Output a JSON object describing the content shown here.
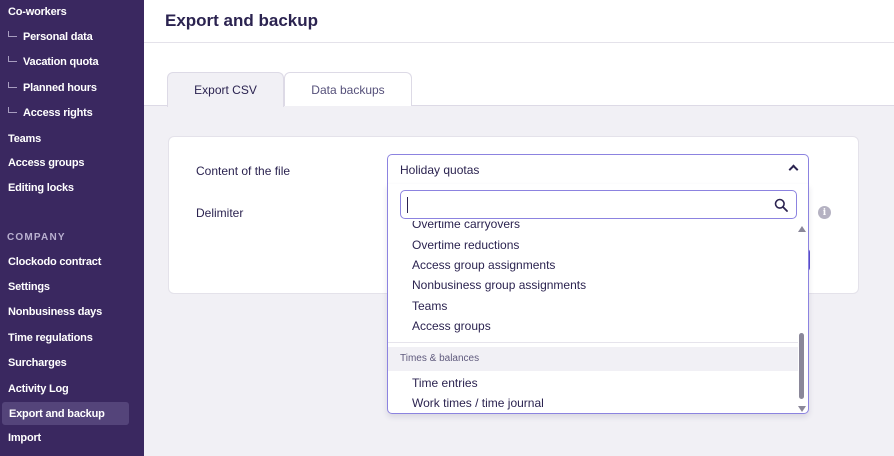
{
  "sidebar": {
    "items_top": [
      {
        "label": "Co-workers"
      },
      {
        "label": "Personal data"
      },
      {
        "label": "Vacation quota"
      },
      {
        "label": "Planned hours"
      },
      {
        "label": "Access rights"
      },
      {
        "label": "Teams"
      },
      {
        "label": "Access groups"
      },
      {
        "label": "Editing locks"
      }
    ],
    "section_company": "COMPANY",
    "items_company": [
      {
        "label": "Clockodo contract"
      },
      {
        "label": "Settings"
      },
      {
        "label": "Nonbusiness days"
      },
      {
        "label": "Time regulations"
      },
      {
        "label": "Surcharges"
      },
      {
        "label": "Activity Log"
      },
      {
        "label": "Export and backup"
      },
      {
        "label": "Import"
      }
    ]
  },
  "header": {
    "title": "Export and backup"
  },
  "tabs": [
    {
      "label": "Export CSV",
      "active": true
    },
    {
      "label": "Data backups",
      "active": false
    }
  ],
  "form": {
    "content_label": "Content of the file",
    "delimiter_label": "Delimiter",
    "info_icon": "i"
  },
  "select": {
    "value": "Holiday quotas",
    "search_placeholder": "",
    "options_partial": "Overtime carryovers",
    "options": [
      {
        "label": "Overtime reductions"
      },
      {
        "label": "Access group assignments"
      },
      {
        "label": "Nonbusiness group assignments"
      },
      {
        "label": "Teams"
      },
      {
        "label": "Access groups"
      }
    ],
    "group_label": "Times & balances",
    "group_options": [
      {
        "label": "Time entries"
      },
      {
        "label": "Work times / time journal"
      }
    ]
  },
  "colors": {
    "sidebar_bg": "#3a2860",
    "accent": "#8c83e0",
    "text": "#2b2350"
  }
}
